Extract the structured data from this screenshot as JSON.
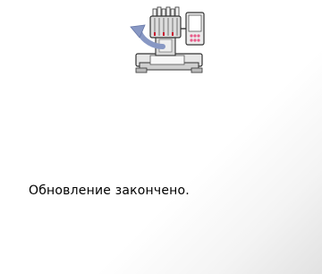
{
  "screen": {
    "message": "Обновление закончено.",
    "illustration": "embroidery-machine-update-icon"
  },
  "colors": {
    "background": "#ffffff",
    "text": "#000000",
    "arrow": "#7f8fb8",
    "machine_body": "#d9d9d9",
    "machine_outline": "#333333",
    "needle_accent": "#c8102e",
    "panel_buttons": "#e85c8a"
  }
}
